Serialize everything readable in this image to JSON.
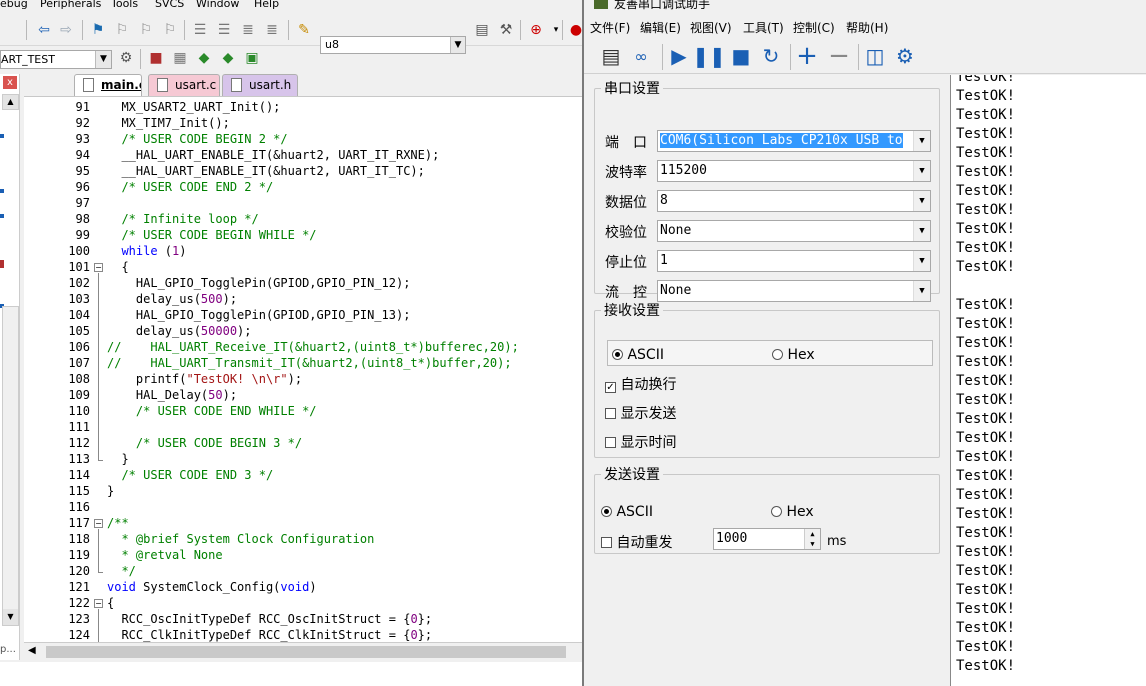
{
  "ide": {
    "menu": [
      "ebug",
      "Peripherals",
      "Tools",
      "SVCS",
      "Window",
      "Help"
    ],
    "find_value": "u8",
    "target_value": "ART_TEST",
    "tabs": [
      {
        "label": "main.c",
        "color": "#ffffff"
      },
      {
        "label": "usart.c",
        "color": "#f6c9d4"
      },
      {
        "label": "usart.h",
        "color": "#d7c4ea"
      }
    ],
    "proj_close": "x",
    "proj_bottom": "p...",
    "code_lines": [
      {
        "n": "91",
        "segs": [
          {
            "t": "  MX_USART2_UART_Init();",
            "c": ""
          }
        ]
      },
      {
        "n": "92",
        "segs": [
          {
            "t": "  MX_TIM7_Init();",
            "c": ""
          }
        ]
      },
      {
        "n": "93",
        "segs": [
          {
            "t": "  /* USER CODE BEGIN 2 */",
            "c": "cm"
          }
        ]
      },
      {
        "n": "94",
        "segs": [
          {
            "t": "  __HAL_UART_ENABLE_IT(&huart2, UART_IT_RXNE);",
            "c": ""
          }
        ]
      },
      {
        "n": "95",
        "segs": [
          {
            "t": "  __HAL_UART_ENABLE_IT(&huart2, UART_IT_TC);",
            "c": ""
          }
        ]
      },
      {
        "n": "96",
        "segs": [
          {
            "t": "  /* USER CODE END 2 */",
            "c": "cm"
          }
        ]
      },
      {
        "n": "97",
        "segs": [
          {
            "t": "",
            "c": ""
          }
        ]
      },
      {
        "n": "98",
        "segs": [
          {
            "t": "  /* Infinite loop */",
            "c": "cm"
          }
        ]
      },
      {
        "n": "99",
        "segs": [
          {
            "t": "  /* USER CODE BEGIN WHILE */",
            "c": "cm"
          }
        ]
      },
      {
        "n": "100",
        "segs": [
          {
            "t": "  ",
            "c": ""
          },
          {
            "t": "while",
            "c": "kw"
          },
          {
            "t": " (",
            "c": ""
          },
          {
            "t": "1",
            "c": "nm"
          },
          {
            "t": ")",
            "c": ""
          }
        ]
      },
      {
        "n": "101",
        "segs": [
          {
            "t": "  {",
            "c": ""
          }
        ]
      },
      {
        "n": "102",
        "segs": [
          {
            "t": "    HAL_GPIO_TogglePin(GPIOD,GPIO_PIN_12);",
            "c": ""
          }
        ]
      },
      {
        "n": "103",
        "segs": [
          {
            "t": "    delay_us(",
            "c": ""
          },
          {
            "t": "500",
            "c": "nm"
          },
          {
            "t": ");",
            "c": ""
          }
        ]
      },
      {
        "n": "104",
        "segs": [
          {
            "t": "    HAL_GPIO_TogglePin(GPIOD,GPIO_PIN_13);",
            "c": ""
          }
        ]
      },
      {
        "n": "105",
        "segs": [
          {
            "t": "    delay_us(",
            "c": ""
          },
          {
            "t": "50000",
            "c": "nm"
          },
          {
            "t": ");",
            "c": ""
          }
        ]
      },
      {
        "n": "106",
        "segs": [
          {
            "t": "//    HAL_UART_Receive_IT(&huart2,(uint8_t*)bufferec,20);",
            "c": "cm"
          }
        ]
      },
      {
        "n": "107",
        "segs": [
          {
            "t": "//    HAL_UART_Transmit_IT(&huart2,(uint8_t*)buffer,20);",
            "c": "cm"
          }
        ]
      },
      {
        "n": "108",
        "segs": [
          {
            "t": "    printf(",
            "c": ""
          },
          {
            "t": "\"TestOK! \\n\\r\"",
            "c": "st"
          },
          {
            "t": ");",
            "c": ""
          }
        ]
      },
      {
        "n": "109",
        "segs": [
          {
            "t": "    HAL_Delay(",
            "c": ""
          },
          {
            "t": "50",
            "c": "nm"
          },
          {
            "t": ");",
            "c": ""
          }
        ]
      },
      {
        "n": "110",
        "segs": [
          {
            "t": "    /* USER CODE END WHILE */",
            "c": "cm"
          }
        ]
      },
      {
        "n": "111",
        "segs": [
          {
            "t": "",
            "c": ""
          }
        ]
      },
      {
        "n": "112",
        "segs": [
          {
            "t": "    /* USER CODE BEGIN 3 */",
            "c": "cm"
          }
        ]
      },
      {
        "n": "113",
        "segs": [
          {
            "t": "  }",
            "c": ""
          }
        ]
      },
      {
        "n": "114",
        "segs": [
          {
            "t": "  /* USER CODE END 3 */",
            "c": "cm"
          }
        ]
      },
      {
        "n": "115",
        "segs": [
          {
            "t": "}",
            "c": ""
          }
        ]
      },
      {
        "n": "116",
        "segs": [
          {
            "t": "",
            "c": ""
          }
        ]
      },
      {
        "n": "117",
        "segs": [
          {
            "t": "/**",
            "c": "cm"
          }
        ]
      },
      {
        "n": "118",
        "segs": [
          {
            "t": "  * @brief System Clock Configuration",
            "c": "cm"
          }
        ]
      },
      {
        "n": "119",
        "segs": [
          {
            "t": "  * @retval None",
            "c": "cm"
          }
        ]
      },
      {
        "n": "120",
        "segs": [
          {
            "t": "  */",
            "c": "cm"
          }
        ]
      },
      {
        "n": "121",
        "segs": [
          {
            "t": "void",
            "c": "kw"
          },
          {
            "t": " SystemClock_Config(",
            "c": ""
          },
          {
            "t": "void",
            "c": "kw"
          },
          {
            "t": ")",
            "c": ""
          }
        ]
      },
      {
        "n": "122",
        "segs": [
          {
            "t": "{",
            "c": ""
          }
        ]
      },
      {
        "n": "123",
        "segs": [
          {
            "t": "  RCC_OscInitTypeDef RCC_OscInitStruct = {",
            "c": ""
          },
          {
            "t": "0",
            "c": "nm"
          },
          {
            "t": "};",
            "c": ""
          }
        ]
      },
      {
        "n": "124",
        "segs": [
          {
            "t": "  RCC_ClkInitTypeDef RCC_ClkInitStruct = {",
            "c": ""
          },
          {
            "t": "0",
            "c": "nm"
          },
          {
            "t": "};",
            "c": ""
          }
        ]
      }
    ]
  },
  "serial": {
    "title": "友善串口调试助手",
    "menu": [
      "文件(F)",
      "编辑(E)",
      "视图(V)",
      "工具(T)",
      "控制(C)",
      "帮助(H)"
    ],
    "port_settings": {
      "legend": "串口设置",
      "rows": [
        {
          "label": "端　口",
          "value": "COM6(Silicon Labs CP210x USB to"
        },
        {
          "label": "波特率",
          "value": "115200"
        },
        {
          "label": "数据位",
          "value": "8"
        },
        {
          "label": "校验位",
          "value": "None"
        },
        {
          "label": "停止位",
          "value": "1"
        },
        {
          "label": "流　控",
          "value": "None"
        }
      ]
    },
    "recv_settings": {
      "legend": "接收设置",
      "ascii": "ASCII",
      "hex": "Hex",
      "auto_wrap": "自动换行",
      "show_send": "显示发送",
      "show_time": "显示时间"
    },
    "send_settings": {
      "legend": "发送设置",
      "ascii": "ASCII",
      "hex": "Hex",
      "auto_resend": "自动重发",
      "interval": "1000",
      "unit": "ms"
    },
    "rx_lines": [
      "TestOK!",
      "TestOK!",
      "TestOK!",
      "TestOK!",
      "TestOK!",
      "TestOK!",
      "TestOK!",
      "TestOK!",
      "TestOK!",
      "TestOK!",
      "TestOK!",
      "",
      "TestOK!",
      "TestOK!",
      "TestOK!",
      "TestOK!",
      "TestOK!",
      "TestOK!",
      "TestOK!",
      "TestOK!",
      "TestOK!",
      "TestOK!",
      "TestOK!",
      "TestOK!",
      "TestOK!",
      "TestOK!",
      "TestOK!",
      "TestOK!",
      "TestOK!",
      "TestOK!",
      "TestOK!",
      "TestOK!"
    ]
  }
}
